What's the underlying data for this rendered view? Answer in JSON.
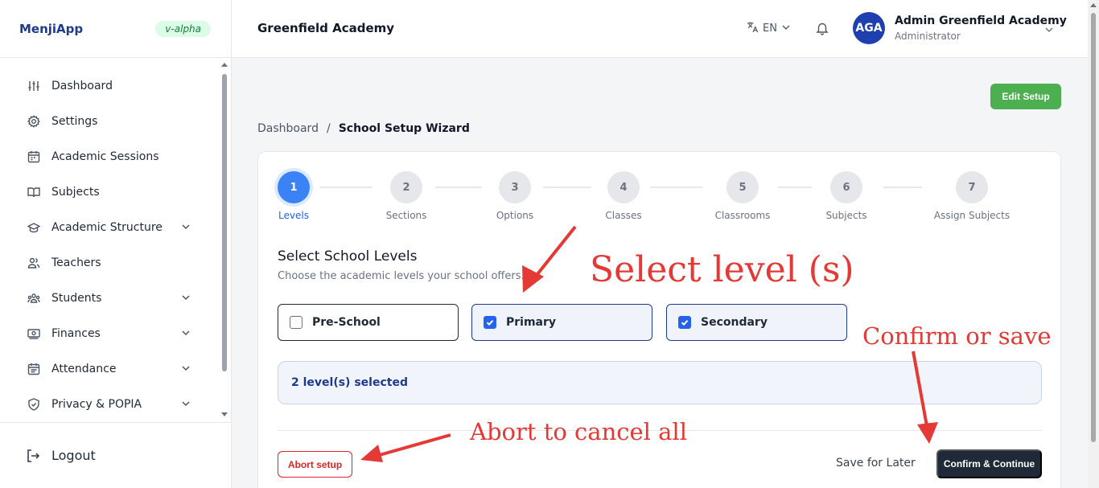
{
  "app": {
    "name": "MenjiApp",
    "version_badge": "v-alpha"
  },
  "sidebar": {
    "items": [
      {
        "label": "Dashboard",
        "icon": "sliders-icon",
        "has_chevron": false
      },
      {
        "label": "Settings",
        "icon": "gear-icon",
        "has_chevron": false
      },
      {
        "label": "Academic Sessions",
        "icon": "calendar-icon",
        "has_chevron": false
      },
      {
        "label": "Subjects",
        "icon": "book-icon",
        "has_chevron": false
      },
      {
        "label": "Academic Structure",
        "icon": "graduation-cap-icon",
        "has_chevron": true
      },
      {
        "label": "Teachers",
        "icon": "users-icon",
        "has_chevron": false
      },
      {
        "label": "Students",
        "icon": "group-icon",
        "has_chevron": true
      },
      {
        "label": "Finances",
        "icon": "cash-icon",
        "has_chevron": true
      },
      {
        "label": "Attendance",
        "icon": "calendar-check-icon",
        "has_chevron": true
      },
      {
        "label": "Privacy & POPIA",
        "icon": "shield-icon",
        "has_chevron": true
      }
    ],
    "logout_label": "Logout"
  },
  "header": {
    "school_name": "Greenfield Academy",
    "language": "EN",
    "user": {
      "initials": "AGA",
      "name": "Admin Greenfield Academy",
      "role": "Administrator"
    }
  },
  "actions": {
    "edit_setup": "Edit Setup"
  },
  "breadcrumb": {
    "root": "Dashboard",
    "separator": "/",
    "current": "School Setup Wizard"
  },
  "wizard": {
    "steps": [
      {
        "number": "1",
        "label": "Levels",
        "active": true
      },
      {
        "number": "2",
        "label": "Sections",
        "active": false
      },
      {
        "number": "3",
        "label": "Options",
        "active": false
      },
      {
        "number": "4",
        "label": "Classes",
        "active": false
      },
      {
        "number": "5",
        "label": "Classrooms",
        "active": false
      },
      {
        "number": "6",
        "label": "Subjects",
        "active": false
      },
      {
        "number": "7",
        "label": "Assign Subjects",
        "active": false
      }
    ],
    "title": "Select School Levels",
    "subtitle": "Choose the academic levels your school offers.",
    "levels": [
      {
        "label": "Pre-School",
        "checked": false
      },
      {
        "label": "Primary",
        "checked": true
      },
      {
        "label": "Secondary",
        "checked": true
      }
    ],
    "summary": "2 level(s) selected",
    "abort_label": "Abort setup",
    "save_later_label": "Save for Later",
    "confirm_label": "Confirm & Continue"
  },
  "annotations": {
    "select_levels": "Select level (s)",
    "confirm_or_save": "Confirm or save",
    "abort_cancel": "Abort to cancel all",
    "color": "#e53935"
  },
  "colors": {
    "brand": "#1e3a8a",
    "active_step": "#3b82f6",
    "edit_button": "#4caf50",
    "confirm_button": "#1f2937",
    "abort": "#dc2626"
  }
}
